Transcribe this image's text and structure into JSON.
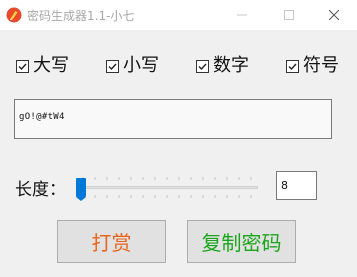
{
  "window": {
    "title": "密码生成器1.1-小七"
  },
  "options": [
    {
      "label": "大写",
      "checked": true
    },
    {
      "label": "小写",
      "checked": true
    },
    {
      "label": "数字",
      "checked": true
    },
    {
      "label": "符号",
      "checked": true
    }
  ],
  "password": {
    "value": "gO!@#tW4"
  },
  "length": {
    "label": "长度：",
    "value": "8"
  },
  "buttons": {
    "tip_label": "打赏",
    "copy_label": "复制密码"
  },
  "colors": {
    "accent": "#0078d7",
    "tip_text": "#e8641b",
    "copy_text": "#1aa51a"
  },
  "icons": {
    "app": "pen-nib-icon",
    "minimize": "minimize-icon",
    "maximize": "maximize-icon",
    "close": "close-icon"
  }
}
